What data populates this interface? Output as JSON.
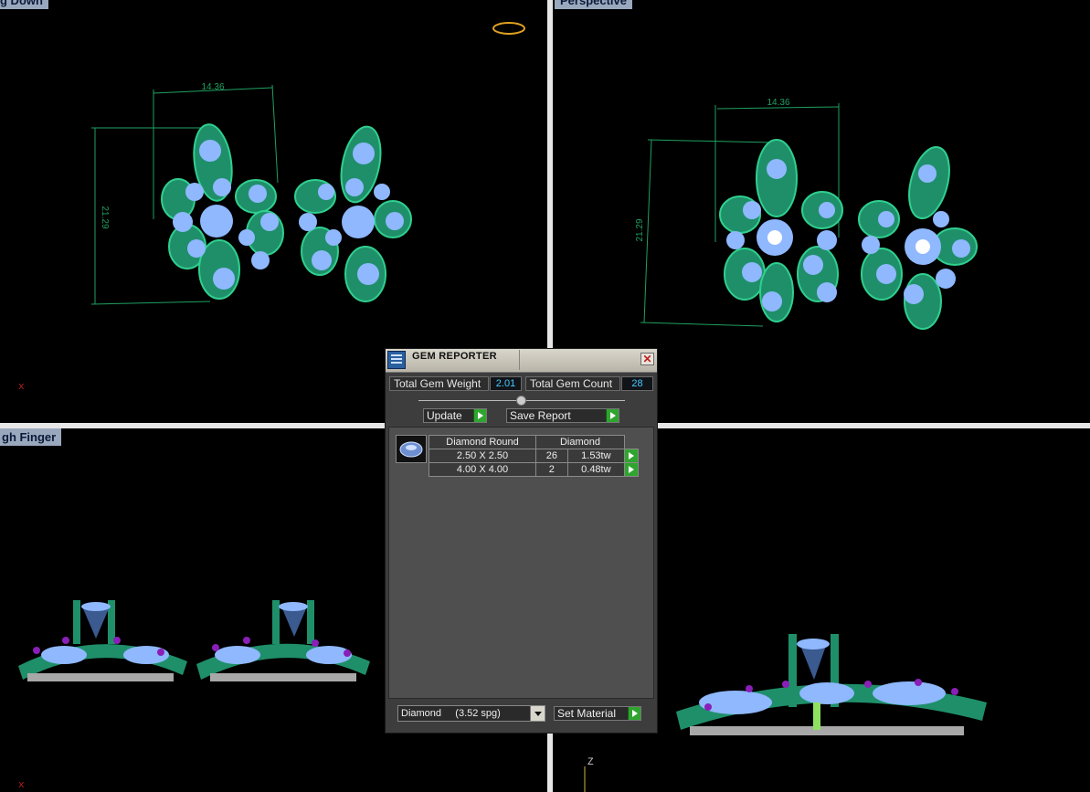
{
  "viewports": {
    "top_left": {
      "label": "g Down"
    },
    "top_right": {
      "label": "Perspective"
    },
    "bottom_left": {
      "label": "gh Finger"
    }
  },
  "dimensions": {
    "top_width": "14.36",
    "top_height": "21.29",
    "persp_width": "14.36",
    "persp_height": "21.29"
  },
  "axes": {
    "x": "x",
    "z": "Z"
  },
  "gem_reporter": {
    "title": "GEM REPORTER",
    "close_symbol": "✕",
    "total_weight_label": "Total Gem Weight",
    "total_weight_value": "2.01",
    "total_count_label": "Total Gem Count",
    "total_count_value": "28",
    "update_label": "Update",
    "save_report_label": "Save Report",
    "table": {
      "header_cut": "Diamond Round",
      "header_material": "Diamond",
      "rows": [
        {
          "size": "2.50 X 2.50",
          "count": "26",
          "weight": "1.53tw"
        },
        {
          "size": "4.00 X 4.00",
          "count": "2",
          "weight": "0.48tw"
        }
      ]
    },
    "material_select": "Diamond     (3.52 spg)",
    "set_material_label": "Set Material"
  },
  "colors": {
    "metal": "#1f8f6a",
    "gem": "#8fb8ff",
    "accent_gem": "#8a1fb8",
    "dimension": "#1fa060",
    "value_text": "#47c9ff",
    "button_arrow": "#2fa52f"
  }
}
